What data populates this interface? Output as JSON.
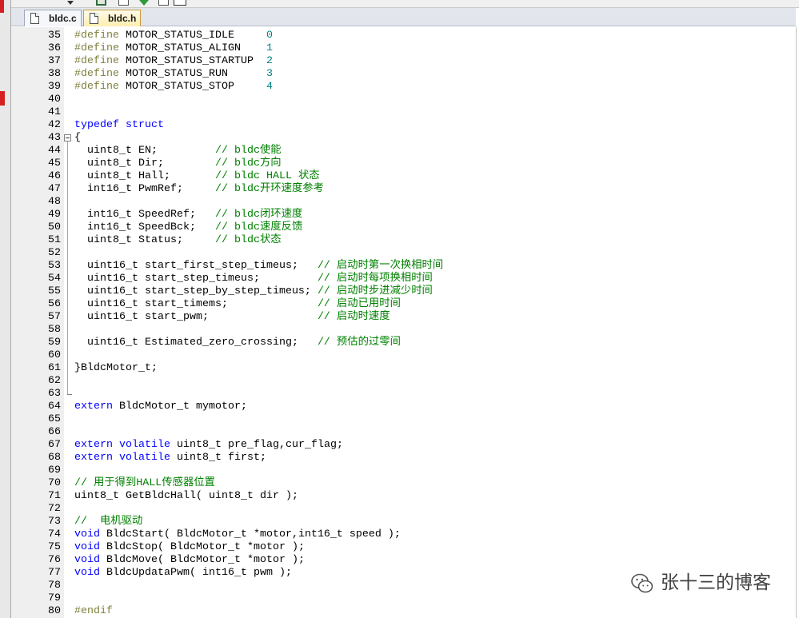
{
  "toolbar": {
    "icons": [
      "dropdown-arrow-icon",
      "window-icon",
      "page-icon",
      "download-arrow-icon",
      "page-icon",
      "window-icon"
    ]
  },
  "tabs": [
    {
      "label": "bldc.c",
      "icon": "file-icon",
      "active": false
    },
    {
      "label": "bldc.h",
      "icon": "file-icon",
      "active": true
    }
  ],
  "editor": {
    "lines": [
      {
        "n": "35",
        "tokens": [
          {
            "pp": "#define"
          },
          {
            "tx": " MOTOR_STATUS_IDLE     "
          },
          {
            "num": "0"
          }
        ]
      },
      {
        "n": "36",
        "tokens": [
          {
            "pp": "#define"
          },
          {
            "tx": " MOTOR_STATUS_ALIGN    "
          },
          {
            "num": "1"
          }
        ]
      },
      {
        "n": "37",
        "tokens": [
          {
            "pp": "#define"
          },
          {
            "tx": " MOTOR_STATUS_STARTUP  "
          },
          {
            "num": "2"
          }
        ]
      },
      {
        "n": "38",
        "tokens": [
          {
            "pp": "#define"
          },
          {
            "tx": " MOTOR_STATUS_RUN      "
          },
          {
            "num": "3"
          }
        ]
      },
      {
        "n": "39",
        "tokens": [
          {
            "pp": "#define"
          },
          {
            "tx": " MOTOR_STATUS_STOP     "
          },
          {
            "num": "4"
          }
        ]
      },
      {
        "n": "40",
        "tokens": []
      },
      {
        "n": "41",
        "tokens": []
      },
      {
        "n": "42",
        "tokens": [
          {
            "kw": "typedef"
          },
          {
            "tx": " "
          },
          {
            "kw": "struct"
          }
        ]
      },
      {
        "n": "43",
        "tokens": [
          {
            "tx": "{"
          }
        ]
      },
      {
        "n": "44",
        "tokens": [
          {
            "tx": "  uint8_t EN;         "
          },
          {
            "cm": "// bldc使能"
          }
        ]
      },
      {
        "n": "45",
        "tokens": [
          {
            "tx": "  uint8_t Dir;        "
          },
          {
            "cm": "// bldc方向"
          }
        ]
      },
      {
        "n": "46",
        "tokens": [
          {
            "tx": "  uint8_t Hall;       "
          },
          {
            "cm": "// bldc HALL 状态"
          }
        ]
      },
      {
        "n": "47",
        "tokens": [
          {
            "tx": "  int16_t PwmRef;     "
          },
          {
            "cm": "// bldc开环速度参考"
          }
        ]
      },
      {
        "n": "48",
        "tokens": []
      },
      {
        "n": "49",
        "tokens": [
          {
            "tx": "  int16_t SpeedRef;   "
          },
          {
            "cm": "// bldc闭环速度"
          }
        ]
      },
      {
        "n": "50",
        "tokens": [
          {
            "tx": "  int16_t SpeedBck;   "
          },
          {
            "cm": "// bldc速度反馈"
          }
        ]
      },
      {
        "n": "51",
        "tokens": [
          {
            "tx": "  uint8_t Status;     "
          },
          {
            "cm": "// bldc状态"
          }
        ]
      },
      {
        "n": "52",
        "tokens": []
      },
      {
        "n": "53",
        "tokens": [
          {
            "tx": "  uint16_t start_first_step_timeus;   "
          },
          {
            "cm": "// 启动时第一次换相时间"
          }
        ]
      },
      {
        "n": "54",
        "tokens": [
          {
            "tx": "  uint16_t start_step_timeus;         "
          },
          {
            "cm": "// 启动时每项换相时间"
          }
        ]
      },
      {
        "n": "55",
        "tokens": [
          {
            "tx": "  uint16_t start_step_by_step_timeus; "
          },
          {
            "cm": "// 启动时步进减少时间"
          }
        ]
      },
      {
        "n": "56",
        "tokens": [
          {
            "tx": "  uint16_t start_timems;              "
          },
          {
            "cm": "// 启动已用时间"
          }
        ]
      },
      {
        "n": "57",
        "tokens": [
          {
            "tx": "  uint16_t start_pwm;                 "
          },
          {
            "cm": "// 启动时速度"
          }
        ]
      },
      {
        "n": "58",
        "tokens": []
      },
      {
        "n": "59",
        "tokens": [
          {
            "tx": "  uint16_t Estimated_zero_crossing;   "
          },
          {
            "cm": "// 预估的过零间"
          }
        ]
      },
      {
        "n": "60",
        "tokens": []
      },
      {
        "n": "61",
        "tokens": [
          {
            "tx": "}BldcMotor_t;"
          }
        ]
      },
      {
        "n": "62",
        "tokens": []
      },
      {
        "n": "63",
        "tokens": []
      },
      {
        "n": "64",
        "tokens": [
          {
            "kw": "extern"
          },
          {
            "tx": " BldcMotor_t mymotor;"
          }
        ]
      },
      {
        "n": "65",
        "tokens": []
      },
      {
        "n": "66",
        "tokens": []
      },
      {
        "n": "67",
        "tokens": [
          {
            "kw": "extern"
          },
          {
            "tx": " "
          },
          {
            "kw": "volatile"
          },
          {
            "tx": " uint8_t pre_flag,cur_flag;"
          }
        ]
      },
      {
        "n": "68",
        "tokens": [
          {
            "kw": "extern"
          },
          {
            "tx": " "
          },
          {
            "kw": "volatile"
          },
          {
            "tx": " uint8_t first;"
          }
        ]
      },
      {
        "n": "69",
        "tokens": []
      },
      {
        "n": "70",
        "tokens": [
          {
            "cm": "// 用于得到HALL传感器位置"
          }
        ]
      },
      {
        "n": "71",
        "tokens": [
          {
            "tx": "uint8_t GetBldcHall( uint8_t dir );"
          }
        ]
      },
      {
        "n": "72",
        "tokens": []
      },
      {
        "n": "73",
        "tokens": [
          {
            "cm": "//  电机驱动"
          }
        ]
      },
      {
        "n": "74",
        "tokens": [
          {
            "kw": "void"
          },
          {
            "tx": " BldcStart( BldcMotor_t *motor,int16_t speed );"
          }
        ]
      },
      {
        "n": "75",
        "tokens": [
          {
            "kw": "void"
          },
          {
            "tx": " BldcStop( BldcMotor_t *motor );"
          }
        ]
      },
      {
        "n": "76",
        "tokens": [
          {
            "kw": "void"
          },
          {
            "tx": " BldcMove( BldcMotor_t *motor );"
          }
        ]
      },
      {
        "n": "77",
        "tokens": [
          {
            "kw": "void"
          },
          {
            "tx": " BldcUpdataPwm( int16_t pwm );"
          }
        ]
      },
      {
        "n": "78",
        "tokens": []
      },
      {
        "n": "79",
        "tokens": []
      },
      {
        "n": "80",
        "tokens": [
          {
            "pp": "#endif"
          }
        ]
      }
    ]
  },
  "watermark": {
    "icon": "wechat-icon",
    "text": "张十三的博客"
  },
  "colors": {
    "keyword": "#0000ff",
    "comment": "#008000",
    "number": "#008080",
    "preprocessor": "#808040",
    "text": "#000000",
    "line_number": "#000000",
    "gutter": "#efefef",
    "active_tab": "#ffeeb0",
    "panel_marker": "#d42020"
  }
}
